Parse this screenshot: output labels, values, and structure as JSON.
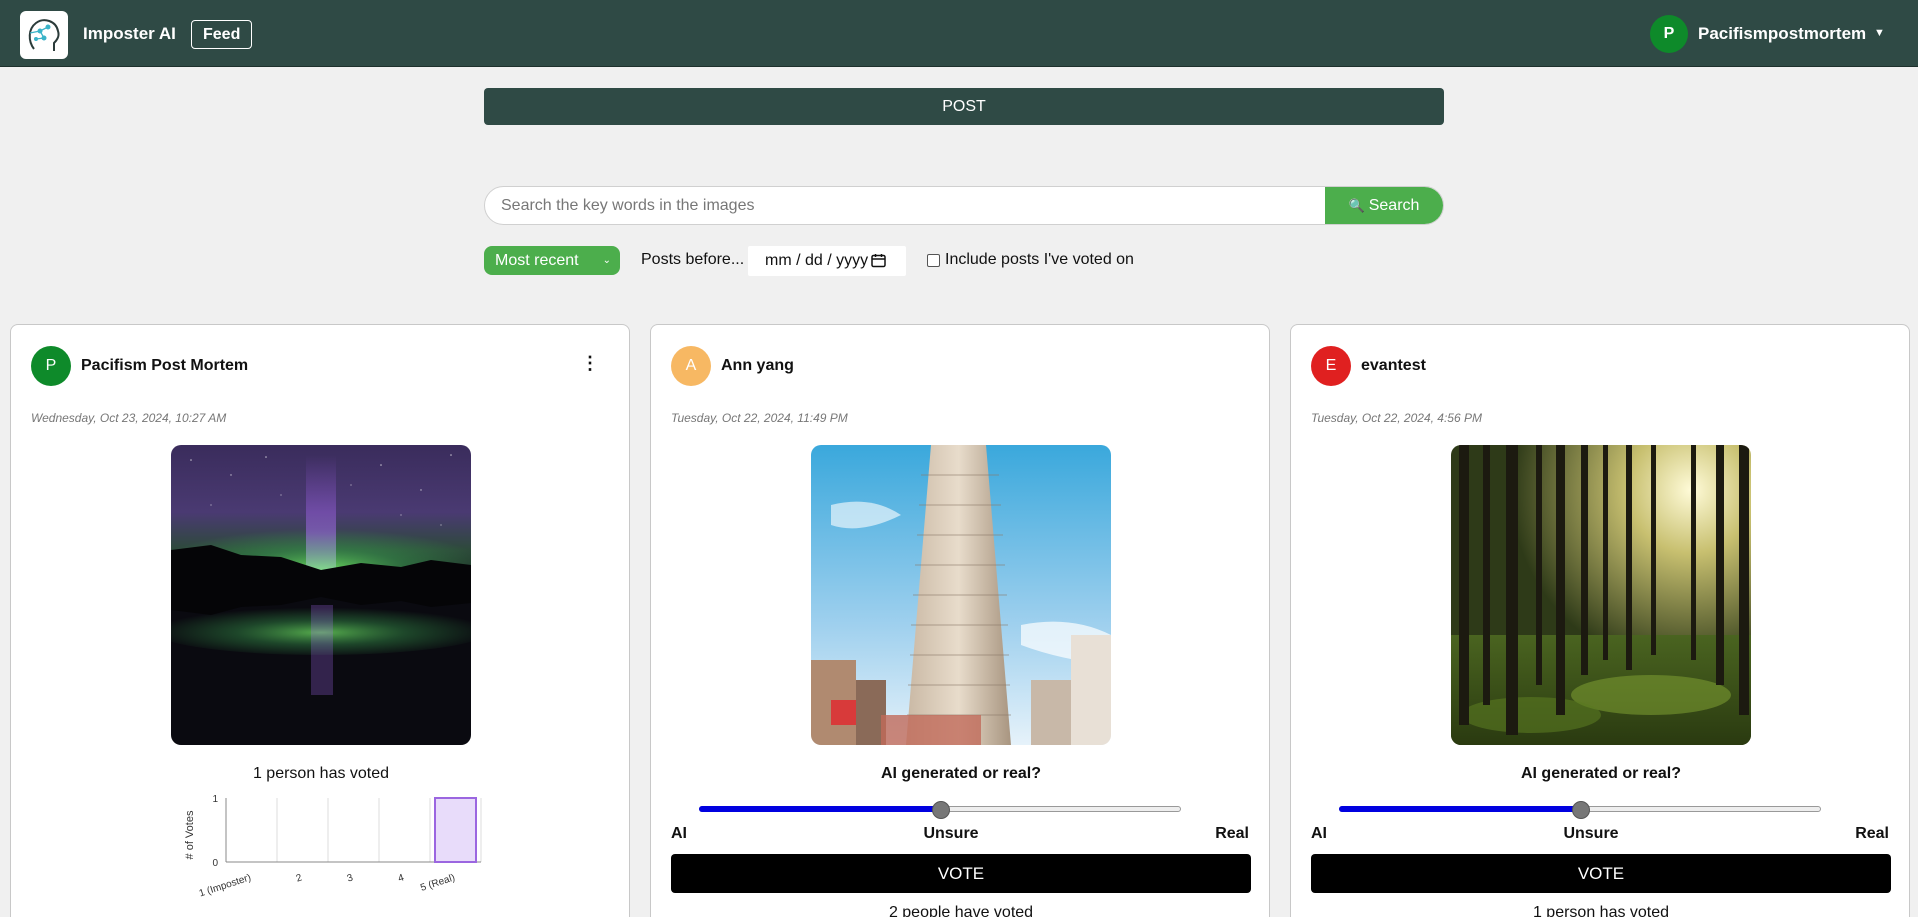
{
  "header": {
    "app_name": "Imposter AI",
    "feed_label": "Feed",
    "user_initial": "P",
    "user_name": "Pacifismpostmortem",
    "brand_color": "#2f4a45"
  },
  "post_button_label": "POST",
  "search": {
    "placeholder": "Search the key words in the images",
    "button_label": "Search",
    "icon": "search-icon"
  },
  "filters": {
    "sort_value": "Most recent",
    "posts_before_label": "Posts before...",
    "date_placeholder": "mm / dd / yyyy",
    "include_voted_label": "Include posts I've voted on",
    "include_voted_checked": false
  },
  "posts": [
    {
      "author_initial": "P",
      "author": "Pacifism Post Mortem",
      "avatar_color": "#0e8a2a",
      "date": "Wednesday, Oct 23, 2024, 10:27 AM",
      "image": "aurora over lake",
      "voted_text": "1 person has voted"
    },
    {
      "author_initial": "A",
      "author": "Ann yang",
      "avatar_color": "#f7b863",
      "date": "Tuesday, Oct 22, 2024, 11:49 PM",
      "image": "flatiron building",
      "question": "AI generated or real?",
      "slider_position": 0.5,
      "label_ai": "AI",
      "label_unsure": "Unsure",
      "label_real": "Real",
      "vote_label": "VOTE",
      "voted_text": "2 people have voted"
    },
    {
      "author_initial": "E",
      "author": "evantest",
      "avatar_color": "#e02020",
      "date": "Tuesday, Oct 22, 2024, 4:56 PM",
      "image": "sunlit forest",
      "question": "AI generated or real?",
      "slider_position": 0.5,
      "label_ai": "AI",
      "label_unsure": "Unsure",
      "label_real": "Real",
      "vote_label": "VOTE",
      "voted_text": "1 person has voted"
    }
  ],
  "chart_data": {
    "type": "bar",
    "categories": [
      "1 (Imposter)",
      "2",
      "3",
      "4",
      "5 (Real)"
    ],
    "values": [
      0,
      0,
      0,
      0,
      1
    ],
    "ylabel": "# of Votes",
    "xlabel": "",
    "ylim": [
      0,
      1
    ],
    "yticks": [
      "1",
      "0"
    ],
    "grid": true,
    "bar_color": "#e8dcfa",
    "bar_edge_color": "#9b66e0"
  }
}
